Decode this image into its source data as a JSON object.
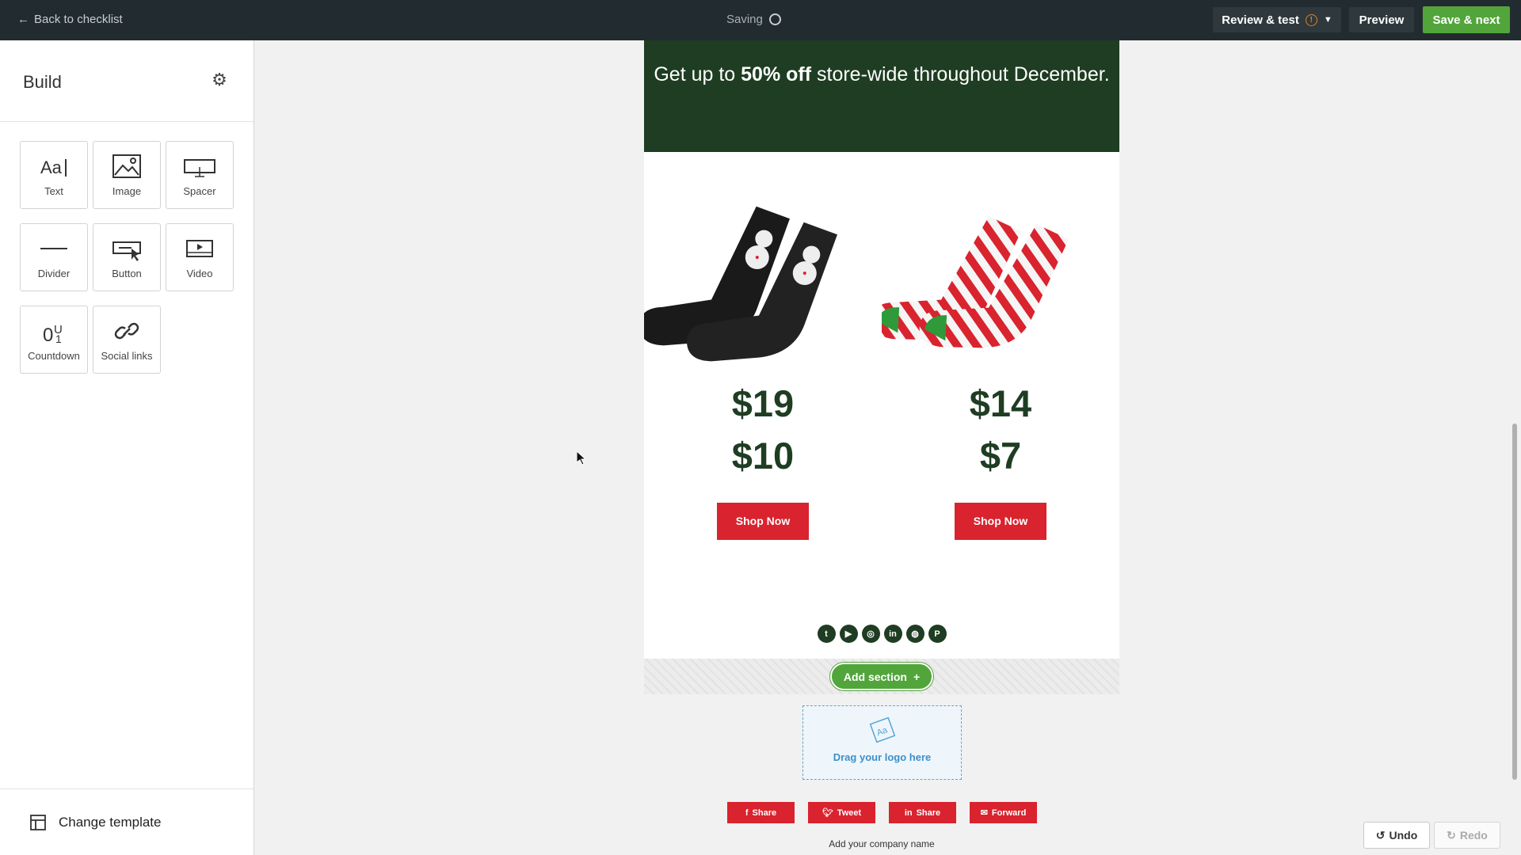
{
  "topbar": {
    "back_label": "Back to checklist",
    "saving_label": "Saving",
    "review_label": "Review & test",
    "preview_label": "Preview",
    "save_next_label": "Save & next"
  },
  "sidebar": {
    "title": "Build",
    "blocks": [
      {
        "label": "Text",
        "icon": "text-icon"
      },
      {
        "label": "Image",
        "icon": "image-icon"
      },
      {
        "label": "Spacer",
        "icon": "spacer-icon"
      },
      {
        "label": "Divider",
        "icon": "divider-icon"
      },
      {
        "label": "Button",
        "icon": "button-icon"
      },
      {
        "label": "Video",
        "icon": "video-icon"
      },
      {
        "label": "Countdown",
        "icon": "countdown-icon"
      },
      {
        "label": "Social links",
        "icon": "link-icon"
      }
    ],
    "change_template_label": "Change template"
  },
  "email": {
    "hero_line_prefix": "Get up to ",
    "hero_bold": "50% off",
    "hero_line_suffix": " store-wide throughout December.",
    "products": [
      {
        "old_price": "$19",
        "new_price": "$10",
        "button": "Shop Now",
        "image": "snowman-socks"
      },
      {
        "old_price": "$14",
        "new_price": "$7",
        "button": "Shop Now",
        "image": "striped-socks"
      }
    ],
    "social_icons": [
      "twitter-icon",
      "youtube-icon",
      "instagram-icon",
      "linkedin-icon",
      "dribbble-icon",
      "pinterest-icon"
    ],
    "add_section_label": "Add section",
    "logo_drop_label": "Drag your logo here",
    "share_buttons": [
      {
        "label": "Share",
        "icon": "facebook-icon"
      },
      {
        "label": "Tweet",
        "icon": "twitter-icon"
      },
      {
        "label": "Share",
        "icon": "linkedin-icon"
      },
      {
        "label": "Forward",
        "icon": "mail-icon"
      }
    ],
    "company_placeholder": "Add your company name"
  },
  "history": {
    "undo_label": "Undo",
    "redo_label": "Redo"
  },
  "colors": {
    "topbar": "#222c30",
    "accent_green": "#52a53b",
    "hero_green": "#1e3d22",
    "cta_red": "#d9232e"
  }
}
